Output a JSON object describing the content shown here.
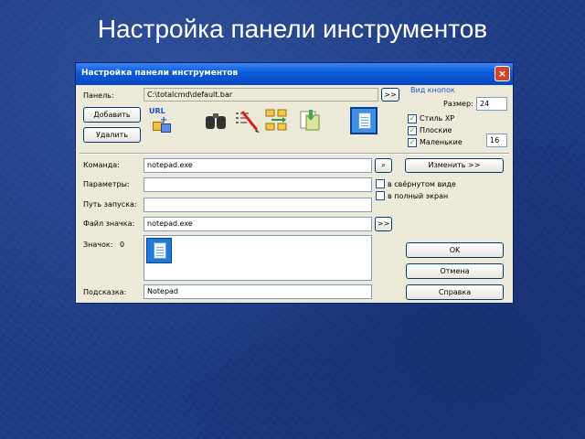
{
  "slide": {
    "title": "Настройка панели инструментов"
  },
  "dialog": {
    "title": "Настройка панели инструментов",
    "close_symbol": "×",
    "panel_label": "Панель:",
    "panel_value": "C:\\totalcmd\\default.bar",
    "browse_symbol": ">>",
    "add_button": "Добавить",
    "delete_button": "Удалить",
    "view_group": {
      "title": "Вид кнопок",
      "size_label": "Размер:",
      "size_value": "24",
      "style_xp_label": "Стиль XP",
      "style_xp_checked": true,
      "flat_label": "Плоские",
      "flat_checked": true,
      "small_label": "Маленькие",
      "small_checked": true,
      "small_value": "16"
    },
    "toolbar_icons": [
      "url-ftp-icon",
      "binoculars-icon",
      "edit-icon",
      "folder-sync-icon",
      "pack-icon",
      "notepad-icon"
    ],
    "url_icon_text": "URL",
    "command_label": "Команда:",
    "command_value": "notepad.exe",
    "change_button": "Изменить >>",
    "params_label": "Параметры:",
    "params_value": "",
    "minimized_label": "в свёрнутом виде",
    "minimized_checked": false,
    "fullscreen_label": "в полный экран",
    "fullscreen_checked": false,
    "start_path_label": "Путь запуска:",
    "start_path_value": "",
    "icon_file_label": "Файл значка:",
    "icon_file_value": "notepad.exe",
    "icon_label": "Значок:",
    "icon_index": "0",
    "tooltip_label": "Подсказка:",
    "tooltip_value": "Notepad",
    "ok_button": "OK",
    "cancel_button": "Отмена",
    "help_button": "Справка"
  }
}
